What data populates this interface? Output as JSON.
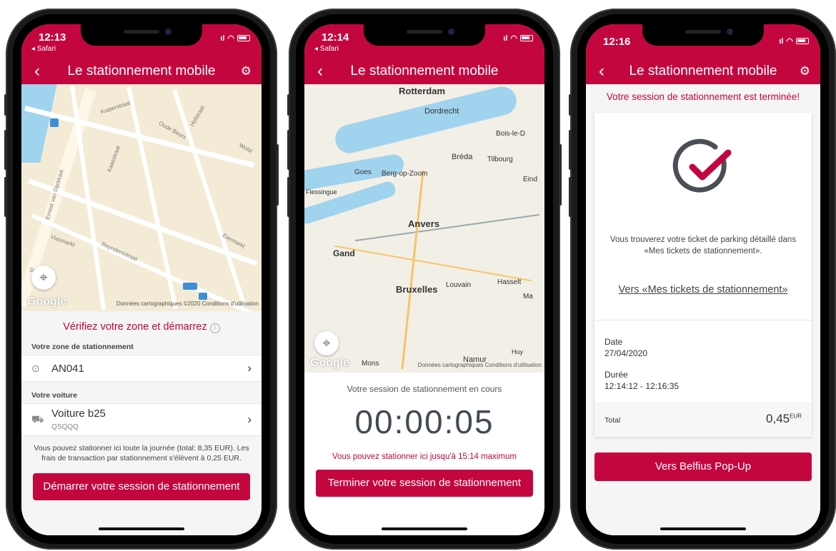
{
  "phone1": {
    "status": {
      "time": "12:13",
      "back_app": "◂ Safari"
    },
    "nav": {
      "back": "‹",
      "title": "Le stationnement mobile"
    },
    "map": {
      "google": "Google",
      "credits": "Données cartographiques ©2020   Conditions d'utilisation",
      "streets": [
        "Kuiperstraat",
        "Hofstraat",
        "Oude Beurs",
        "Kaasstraat",
        "Ernest van Dijckkaai",
        "Vlasmarkt",
        "Reyndersstraat",
        "Stoofstraat",
        "Eiermarkt",
        "Wolst"
      ]
    },
    "sheet_title": "Vérifiez votre zone et démarrez",
    "zone_label": "Votre zone de stationnement",
    "zone_value": "AN041",
    "car_label": "Votre voiture",
    "car_name": "Voiture b25",
    "car_plate": "QSQQQ",
    "info": "Vous pouvez stationner ici toute la journée (total: 8,35 EUR). Les frais de transaction par stationnement s'élèvent à 0,25 EUR.",
    "button": "Démarrer votre session de stationnement"
  },
  "phone2": {
    "status": {
      "time": "12:14",
      "back_app": "◂ Safari"
    },
    "nav": {
      "back": "‹",
      "title": "Le stationnement mobile"
    },
    "map": {
      "google": "Google",
      "credits": "Données cartographiques   Conditions d'utilisation",
      "cities": [
        "Rotterdam",
        "Dordrecht",
        "Bois-le-D",
        "Bréda",
        "Tilbourg",
        "Goes",
        "Berg-op-Zoom",
        "Flessingue",
        "Anvers",
        "Gand",
        "Bruxelles",
        "Louvain",
        "Hasselt",
        "Mons",
        "Namur",
        "Huy",
        "Eind",
        "Ma"
      ]
    },
    "session_label": "Votre session de stationnement en cours",
    "timer": "00:00:05",
    "limit": "Vous pouvez stationner ici jusqu'à 15:14 maximum",
    "button": "Terminer votre session de stationnement"
  },
  "phone3": {
    "status": {
      "time": "12:16"
    },
    "nav": {
      "back": "‹",
      "title": "Le stationnement mobile"
    },
    "ended": "Votre session de stationnement est terminée!",
    "ticket_info": "Vous trouverez votre ticket de parking détaillé dans «Mes tickets de stationnement».",
    "link": "Vers «Mes tickets de stationnement»",
    "date_label": "Date",
    "date_value": "27/04/2020",
    "duration_label": "Durée",
    "duration_value": "12:14:12 - 12:16:35",
    "total_label": "Total",
    "total_value": "0,45",
    "total_currency": "EUR",
    "button": "Vers Belfius Pop-Up"
  },
  "colors": {
    "accent": "#c4063f",
    "map_land": "#f4ebd6",
    "water": "#9fd3ee"
  }
}
